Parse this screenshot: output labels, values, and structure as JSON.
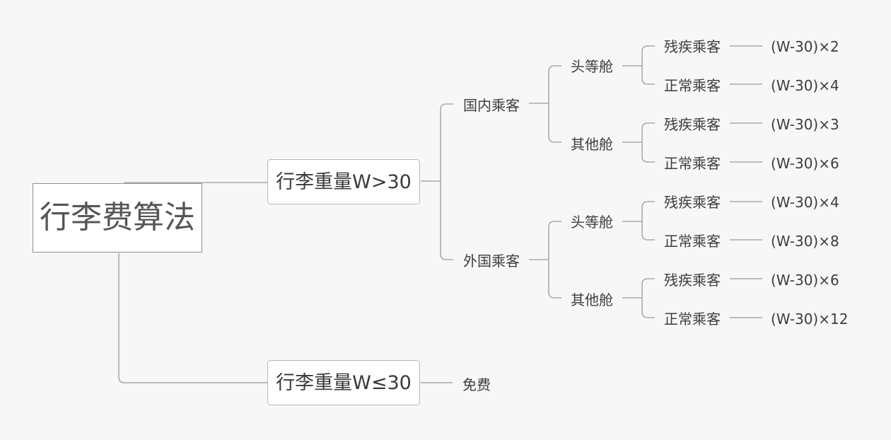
{
  "root": {
    "label": "行李费算法"
  },
  "branches": [
    {
      "label": "行李重量W>30"
    },
    {
      "label": "行李重量W≤30",
      "result": "免费"
    }
  ],
  "passenger_groups": [
    {
      "label": "国内乘客",
      "cabins": [
        {
          "label": "头等舱",
          "rules": [
            {
              "type": "残疾乘客",
              "formula": "(W-30)×2"
            },
            {
              "type": "正常乘客",
              "formula": "(W-30)×4"
            }
          ]
        },
        {
          "label": "其他舱",
          "rules": [
            {
              "type": "残疾乘客",
              "formula": "(W-30)×3"
            },
            {
              "type": "正常乘客",
              "formula": "(W-30)×6"
            }
          ]
        }
      ]
    },
    {
      "label": "外国乘客",
      "cabins": [
        {
          "label": "头等舱",
          "rules": [
            {
              "type": "残疾乘客",
              "formula": "(W-30)×4"
            },
            {
              "type": "正常乘客",
              "formula": "(W-30)×8"
            }
          ]
        },
        {
          "label": "其他舱",
          "rules": [
            {
              "type": "残疾乘客",
              "formula": "(W-30)×6"
            },
            {
              "type": "正常乘客",
              "formula": "(W-30)×12"
            }
          ]
        }
      ]
    }
  ],
  "colors": {
    "line": "#9a9a9a",
    "background": "#f7f7f7"
  }
}
